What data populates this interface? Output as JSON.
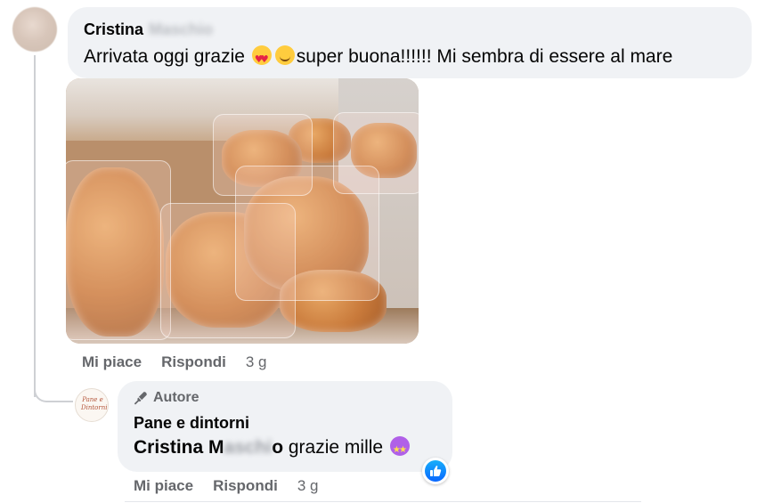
{
  "comment": {
    "author_first": "Cristina",
    "author_last_blurred": "Maschio",
    "text_before_emoji": "Arrivata oggi grazie ",
    "emoji_1": "smiling-face-with-heart-eyes",
    "emoji_2": "smiling-face-with-smiling-eyes",
    "text_after_emoji": "super buona!!!!!! Mi sembra di essere al mare",
    "actions": {
      "like": "Mi piace",
      "reply": "Rispondi",
      "time": "3 g"
    }
  },
  "reply": {
    "badge": "Autore",
    "badge_icon": "microphone-icon",
    "author": "Pane e dintorni",
    "avatar_logo_text": "Pane e Dintorni",
    "mention_start": "Cristina M",
    "mention_blurred": "aschi",
    "mention_end": "o",
    "text": " grazie mille ",
    "emoji": "star-struck",
    "reaction": "like",
    "actions": {
      "like": "Mi piace",
      "reply": "Rispondi",
      "time": "3 g"
    }
  },
  "colors": {
    "bubble": "#f0f2f5",
    "meta_text": "#65676b",
    "like_blue": "#0866ff",
    "thread_line": "#ced0d4"
  }
}
